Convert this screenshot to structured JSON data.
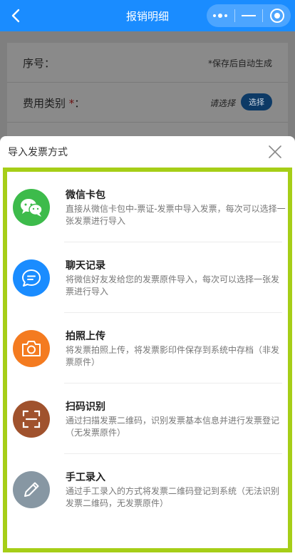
{
  "nav": {
    "title": "报销明细",
    "capsule": {
      "more_icon": "more-dots-icon",
      "minimize_icon": "minimize-icon",
      "close_icon": "target-close-icon"
    }
  },
  "form": {
    "rows": [
      {
        "label": "序号：",
        "value": "*保存后自动生成"
      },
      {
        "label": "费用类别",
        "required_mark": "*",
        "colon": "：",
        "placeholder": "请选择",
        "button": "选择"
      }
    ]
  },
  "sheet": {
    "title": "导入发票方式",
    "close_icon": "close-icon",
    "items": [
      {
        "title": "微信卡包",
        "desc": "直接从微信卡包中-票证-发票中导入发票，每次可以选择一张发票进行导入",
        "icon": "wechat-icon",
        "color": "#3dbb4b"
      },
      {
        "title": "聊天记录",
        "desc": "将微信好友发给您的发票原件导入，每次可以选择一张发票进行导入",
        "icon": "chat-bubble-icon",
        "color": "#1a8cff"
      },
      {
        "title": "拍照上传",
        "desc": "将发票拍照上传，将发票影印件保存到系统中存档（非发票原件）",
        "icon": "camera-icon",
        "color": "#f47b20"
      },
      {
        "title": "扫码识别",
        "desc": "通过扫描发票二维码，识别发票基本信息并进行发票登记（无发票原件）",
        "icon": "scan-icon",
        "color": "#a0522d"
      },
      {
        "title": "手工录入",
        "desc": "通过手工录入的方式将发票二维码登记到系统（无法识别发票二维码，无发票原件）",
        "icon": "pencil-icon",
        "color": "#8797a3"
      }
    ]
  },
  "colors": {
    "nav_bg": "#1a8cff",
    "highlight_border": "#a6ce17"
  }
}
